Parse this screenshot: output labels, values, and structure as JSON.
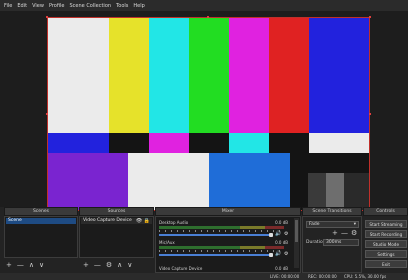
{
  "menu": [
    "File",
    "Edit",
    "View",
    "Profile",
    "Scene Collection",
    "Tools",
    "Help"
  ],
  "colors": {
    "selection": "#1e4b83",
    "preview_border": "#c0302a",
    "white": "#ebebeb",
    "yellow": "#e6e22a",
    "cyan": "#22e6e6",
    "green": "#22dd22",
    "magenta": "#e022e0",
    "red": "#e02222",
    "blue": "#2222dd",
    "purple": "#7a24d0",
    "dark": "#141414",
    "mid_blue": "#1f6dd8"
  },
  "docks": {
    "scenes": "Scenes",
    "sources": "Sources",
    "mixer": "Mixer",
    "transitions": "Scene Transitions",
    "controls": "Controls"
  },
  "scenes": {
    "items": [
      "Scene"
    ],
    "selected": "Scene"
  },
  "sources": {
    "items": [
      {
        "name": "Video Capture Device",
        "visible_icon": "eye-icon",
        "lock_icon": "lock-icon"
      }
    ]
  },
  "toolbar_glyphs": {
    "add": "+",
    "remove": "—",
    "settings": "⚙",
    "up": "∧",
    "down": "∨"
  },
  "mixer": {
    "channels": [
      {
        "name": "Desktop Audio",
        "db": "0.0 dB",
        "level": 1.0
      },
      {
        "name": "Mic/Aux",
        "db": "0.0 dB",
        "level": 1.0
      },
      {
        "name": "Video Capture Device",
        "db": "0.0 dB",
        "level": 1.0
      }
    ]
  },
  "transitions": {
    "selected": "Fade",
    "duration_label": "Duration",
    "duration": "300ms"
  },
  "controls": [
    "Start Streaming",
    "Start Recording",
    "Studio Mode",
    "Settings",
    "Exit"
  ],
  "status": {
    "live": "LIVE: 00:00:00",
    "rec": "REC: 00:00:00",
    "cpu": "CPU: 5.5%, 30.00 fps"
  }
}
